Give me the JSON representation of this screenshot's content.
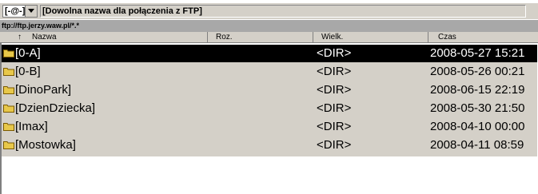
{
  "drive": {
    "label": "[-@-]"
  },
  "connection": {
    "name": "[Dowolna nazwa dla połączenia z FTP]"
  },
  "path": "ftp://ftp.jerzy.waw.pl/*.*",
  "columns": {
    "sort_indicator": "↑",
    "name": "Nazwa",
    "ext": "Roz.",
    "size": "Wielk.",
    "date": "Czas"
  },
  "files": [
    {
      "name": "[0-A]",
      "size": "<DIR>",
      "date": "2008-05-27 15:21",
      "selected": true
    },
    {
      "name": "[0-B]",
      "size": "<DIR>",
      "date": "2008-05-26 00:21",
      "selected": false
    },
    {
      "name": "[DinoPark]",
      "size": "<DIR>",
      "date": "2008-06-15 22:19",
      "selected": false
    },
    {
      "name": "[DzienDziecka]",
      "size": "<DIR>",
      "date": "2008-05-30 21:50",
      "selected": false
    },
    {
      "name": "[Imax]",
      "size": "<DIR>",
      "date": "2008-04-10 00:00",
      "selected": false
    },
    {
      "name": "[Mostowka]",
      "size": "<DIR>",
      "date": "2008-04-11 08:59",
      "selected": false
    }
  ],
  "colors": {
    "list_bg": "#d4d0c8",
    "selected_bg": "#000000",
    "selected_fg": "#ffffff",
    "path_bg": "#a8a8a8",
    "folder": "#e8c84a"
  }
}
